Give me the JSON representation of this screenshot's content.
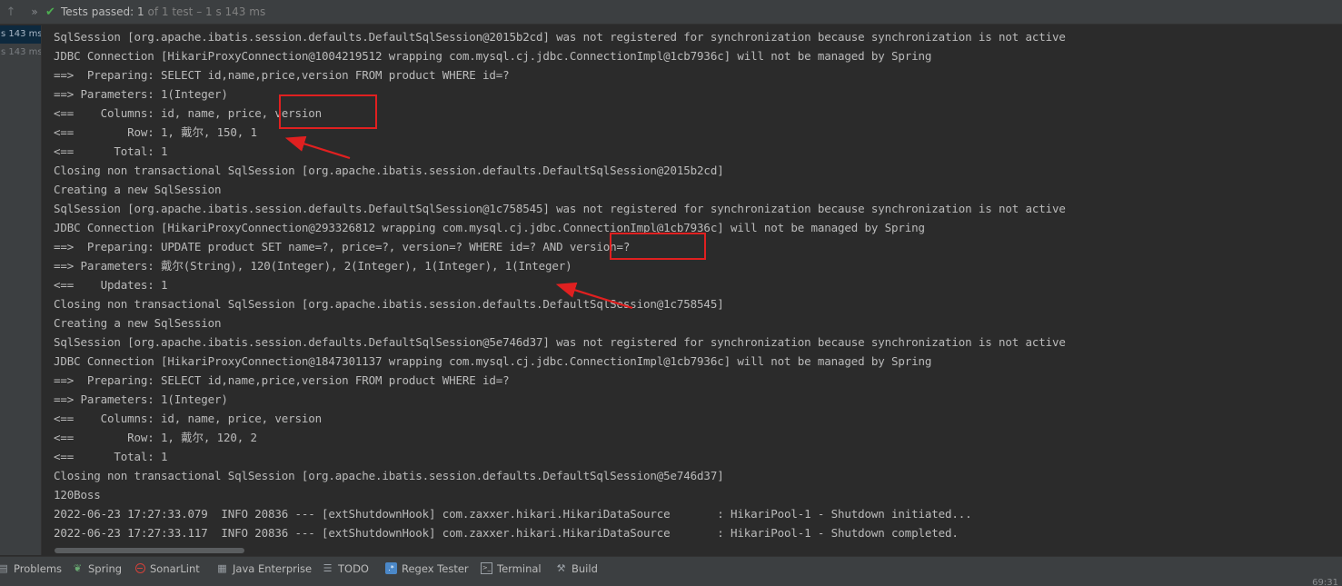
{
  "toolbar": {
    "up_icon": "↑",
    "expand_icon": "»",
    "check_icon": "✔",
    "status_label": "Tests passed:",
    "status_count": "1",
    "status_detail": "of 1 test – 1 s 143 ms"
  },
  "test_tree": {
    "rows": [
      "s 143 ms",
      "s 143 ms"
    ]
  },
  "console": {
    "lines": [
      "SqlSession [org.apache.ibatis.session.defaults.DefaultSqlSession@2015b2cd] was not registered for synchronization because synchronization is not active",
      "JDBC Connection [HikariProxyConnection@1004219512 wrapping com.mysql.cj.jdbc.ConnectionImpl@1cb7936c] will not be managed by Spring",
      "==>  Preparing: SELECT id,name,price,version FROM product WHERE id=?",
      "==> Parameters: 1(Integer)",
      "<==    Columns: id, name, price, version",
      "<==        Row: 1, 戴尔, 150, 1",
      "<==      Total: 1",
      "Closing non transactional SqlSession [org.apache.ibatis.session.defaults.DefaultSqlSession@2015b2cd]",
      "Creating a new SqlSession",
      "SqlSession [org.apache.ibatis.session.defaults.DefaultSqlSession@1c758545] was not registered for synchronization because synchronization is not active",
      "JDBC Connection [HikariProxyConnection@293326812 wrapping com.mysql.cj.jdbc.ConnectionImpl@1cb7936c] will not be managed by Spring",
      "==>  Preparing: UPDATE product SET name=?, price=?, version=? WHERE id=? AND version=?",
      "==> Parameters: 戴尔(String), 120(Integer), 2(Integer), 1(Integer), 1(Integer)",
      "<==    Updates: 1",
      "Closing non transactional SqlSession [org.apache.ibatis.session.defaults.DefaultSqlSession@1c758545]",
      "Creating a new SqlSession",
      "SqlSession [org.apache.ibatis.session.defaults.DefaultSqlSession@5e746d37] was not registered for synchronization because synchronization is not active",
      "JDBC Connection [HikariProxyConnection@1847301137 wrapping com.mysql.cj.jdbc.ConnectionImpl@1cb7936c] will not be managed by Spring",
      "==>  Preparing: SELECT id,name,price,version FROM product WHERE id=?",
      "==> Parameters: 1(Integer)",
      "<==    Columns: id, name, price, version",
      "<==        Row: 1, 戴尔, 120, 2",
      "<==      Total: 1",
      "Closing non transactional SqlSession [org.apache.ibatis.session.defaults.DefaultSqlSession@5e746d37]",
      "120Boss",
      "2022-06-23 17:27:33.079  INFO 20836 --- [extShutdownHook] com.zaxxer.hikari.HikariDataSource       : HikariPool-1 - Shutdown initiated...",
      "2022-06-23 17:27:33.117  INFO 20836 --- [extShutdownHook] com.zaxxer.hikari.HikariDataSource       : HikariPool-1 - Shutdown completed."
    ]
  },
  "annotation_color": "#e02020",
  "bottom_tabs": [
    {
      "label": "Problems",
      "icon": "problems-icon"
    },
    {
      "label": "Spring",
      "icon": "spring-icon"
    },
    {
      "label": "SonarLint",
      "icon": "sonarlint-icon"
    },
    {
      "label": "Java Enterprise",
      "icon": "java-enterprise-icon"
    },
    {
      "label": "TODO",
      "icon": "todo-icon"
    },
    {
      "label": "Regex Tester",
      "icon": "regex-tester-icon"
    },
    {
      "label": "Terminal",
      "icon": "terminal-icon"
    },
    {
      "label": "Build",
      "icon": "build-icon"
    }
  ],
  "status_bar": {
    "cursor_position": "69:31"
  }
}
